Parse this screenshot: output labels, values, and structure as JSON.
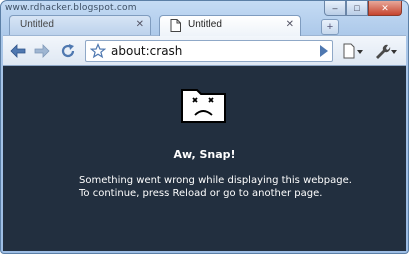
{
  "watermark": "www.rdhacker.blogspot.com",
  "tabs": [
    {
      "title": "Untitled",
      "active": false
    },
    {
      "title": "Untitled",
      "active": true
    }
  ],
  "toolbar": {
    "url": "about:crash"
  },
  "content": {
    "heading": "Aw, Snap!",
    "line1": "Something went wrong while displaying this webpage.",
    "line2": "To continue, press Reload or go to another page."
  },
  "colors": {
    "content_bg": "#222f3f",
    "frame": "#a9c6e8",
    "text": "#ffffff"
  },
  "icons": [
    "back-arrow-icon",
    "forward-arrow-icon",
    "reload-icon",
    "star-icon",
    "go-arrow-icon",
    "page-menu-icon",
    "wrench-icon",
    "sad-folder-icon"
  ]
}
